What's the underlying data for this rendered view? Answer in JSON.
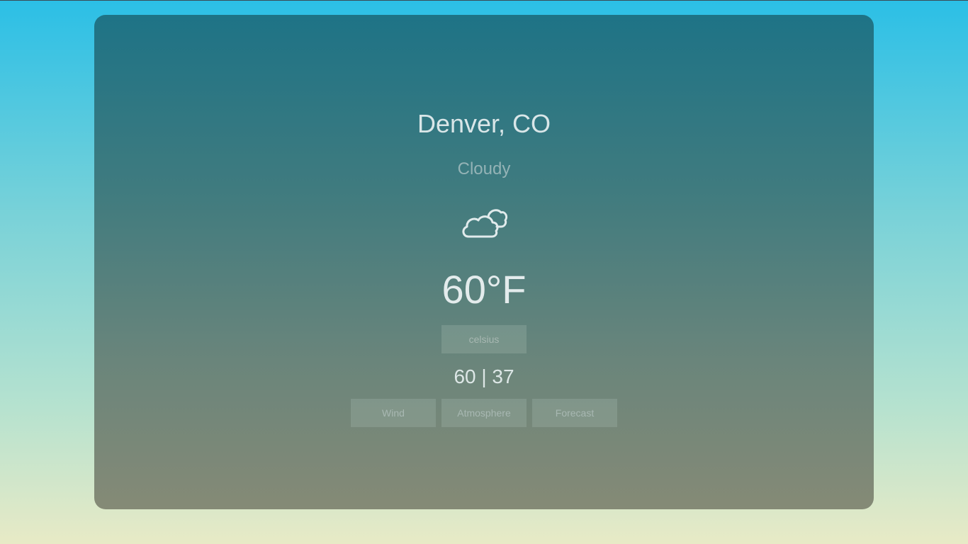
{
  "location": {
    "city": "Denver, CO"
  },
  "current": {
    "condition": "Cloudy",
    "icon": "cloudy-icon",
    "temperature": "60°F",
    "high_low": "60 | 37"
  },
  "controls": {
    "unit_toggle_label": "celsius",
    "tabs": [
      {
        "label": "Wind"
      },
      {
        "label": "Atmosphere"
      },
      {
        "label": "Forecast"
      }
    ]
  },
  "colors": {
    "background_top": "#2bbfe6",
    "background_bottom": "#e8eac6",
    "card_top": "#1e7386",
    "card_bottom": "#858a76",
    "text_primary": "#d9e6e8",
    "text_muted": "#94b3b6"
  }
}
